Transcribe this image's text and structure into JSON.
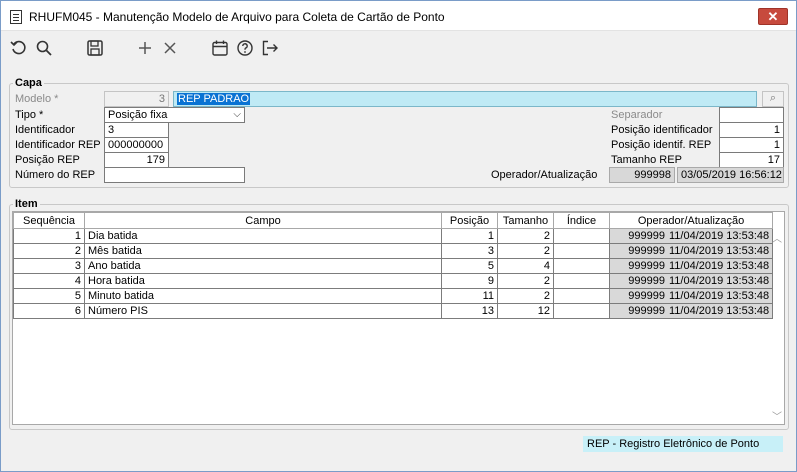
{
  "window": {
    "title": "RHUFM045 - Manutenção Modelo de Arquivo para Coleta de Cartão de Ponto",
    "close_label": "✕"
  },
  "toolbar": {
    "icons": [
      "undo-icon",
      "search-icon",
      "save-icon",
      "add-icon",
      "delete-icon",
      "calendar-icon",
      "help-icon",
      "exit-icon"
    ]
  },
  "capa": {
    "title": "Capa",
    "modelo_label": "Modelo *",
    "modelo_value": "3",
    "modelo_desc": "REP PADRAO",
    "tipo_label": "Tipo *",
    "tipo_value": "Posição fixa",
    "identificador_label": "Identificador",
    "identificador_value": "3",
    "ident_rep_label": "Identificador REP",
    "ident_rep_value": "000000000",
    "posicao_rep_label": "Posição REP",
    "posicao_rep_value": "179",
    "numero_rep_label": "Número do REP",
    "numero_rep_value": "",
    "separador_label": "Separador",
    "separador_value": "",
    "pos_ident_label": "Posição identificador",
    "pos_ident_value": "1",
    "pos_ident_rep_label": "Posição identif. REP",
    "pos_ident_rep_value": "1",
    "tam_rep_label": "Tamanho REP",
    "tam_rep_value": "17",
    "operador_label": "Operador/Atualização",
    "operador_value": "999998",
    "atualizacao_value": "03/05/2019 16:56:12"
  },
  "item": {
    "title": "Item",
    "columns": [
      "Sequência",
      "Campo",
      "Posição",
      "Tamanho",
      "Índice",
      "Operador/Atualização"
    ],
    "rows": [
      {
        "seq": "1",
        "campo": "Dia batida",
        "pos": "1",
        "tam": "2",
        "indice": "",
        "operador": "999999",
        "data": "11/04/2019 13:53:48"
      },
      {
        "seq": "2",
        "campo": "Mês batida",
        "pos": "3",
        "tam": "2",
        "indice": "",
        "operador": "999999",
        "data": "11/04/2019 13:53:48"
      },
      {
        "seq": "3",
        "campo": "Ano batida",
        "pos": "5",
        "tam": "4",
        "indice": "",
        "operador": "999999",
        "data": "11/04/2019 13:53:48"
      },
      {
        "seq": "4",
        "campo": "Hora batida",
        "pos": "9",
        "tam": "2",
        "indice": "",
        "operador": "999999",
        "data": "11/04/2019 13:53:48"
      },
      {
        "seq": "5",
        "campo": "Minuto batida",
        "pos": "11",
        "tam": "2",
        "indice": "",
        "operador": "999999",
        "data": "11/04/2019 13:53:48"
      },
      {
        "seq": "6",
        "campo": "Número PIS",
        "pos": "13",
        "tam": "12",
        "indice": "",
        "operador": "999999",
        "data": "11/04/2019 13:53:48"
      }
    ]
  },
  "statusbar": {
    "text": "REP - Registro Eletrônico de Ponto"
  }
}
